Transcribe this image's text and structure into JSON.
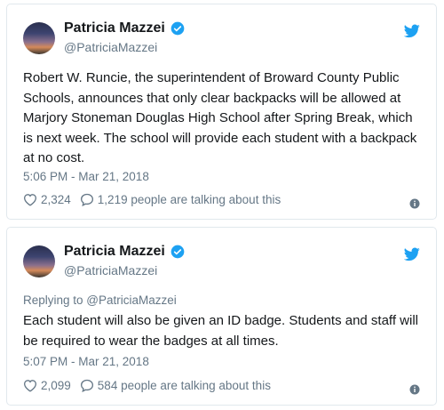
{
  "colors": {
    "twitter_blue": "#1da1f2",
    "text": "#14171a",
    "secondary": "#657786",
    "border": "#e1e8ed"
  },
  "tweets": [
    {
      "name": "Patricia Mazzei",
      "handle": "@PatriciaMazzei",
      "reply_to": "",
      "text": "Robert W. Runcie, the superintendent of Broward County Public Schools, announces that only clear backpacks will be allowed at Marjory Stoneman Douglas High School after Spring Break, which is next week. The school will provide each student with a backpack at no cost.",
      "timestamp": "5:06 PM - Mar 21, 2018",
      "likes": "2,324",
      "talking": "1,219 people are talking about this"
    },
    {
      "name": "Patricia Mazzei",
      "handle": "@PatriciaMazzei",
      "reply_to": "Replying to @PatriciaMazzei",
      "text": "Each student will also be given an ID badge. Students and staff will be required to wear the badges at all times.",
      "timestamp": "5:07 PM - Mar 21, 2018",
      "likes": "2,099",
      "talking": "584 people are talking about this"
    }
  ]
}
